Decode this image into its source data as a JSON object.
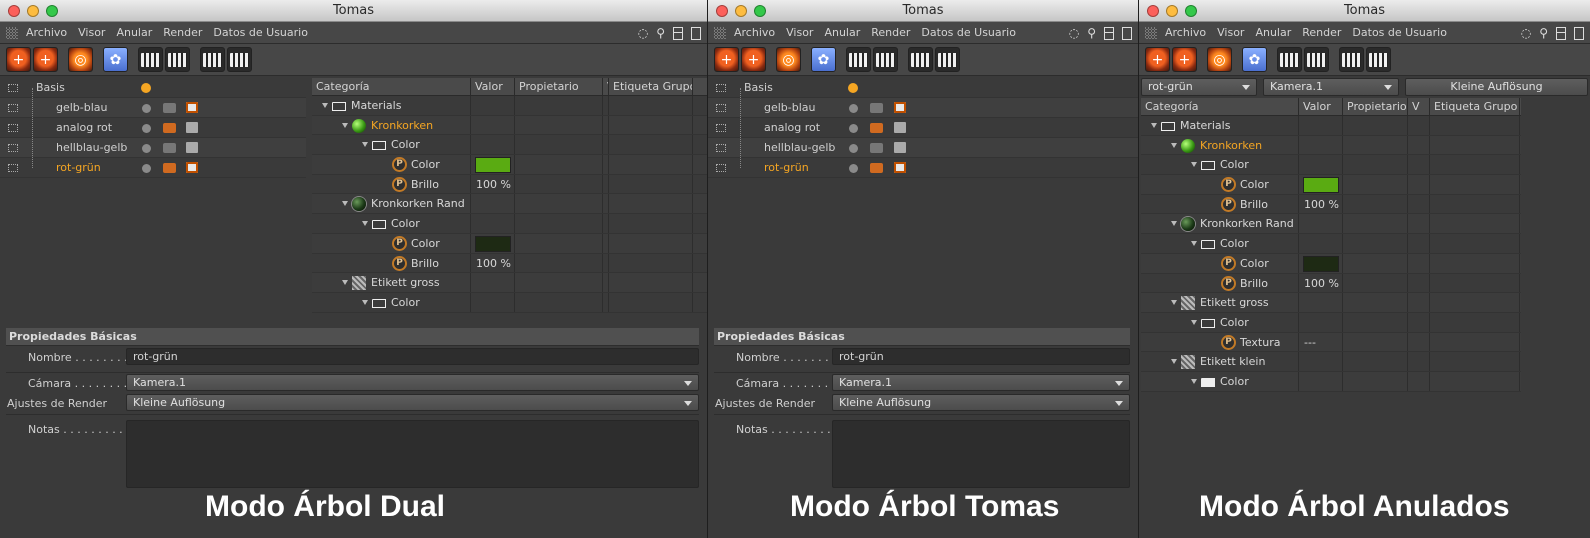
{
  "title": "Tomas",
  "menu": [
    "Archivo",
    "Visor",
    "Anular",
    "Render",
    "Datos de Usuario"
  ],
  "objects": [
    {
      "name": "Basis",
      "active": false,
      "root": true
    },
    {
      "name": "gelb-blau",
      "active": false
    },
    {
      "name": "analog rot",
      "active": false
    },
    {
      "name": "hellblau-gelb",
      "active": false
    },
    {
      "name": "rot-grün",
      "active": true
    }
  ],
  "columns": {
    "categoria": "Categoría",
    "valor": "Valor",
    "propietario": "Propietario",
    "v": "V",
    "etiqueta": "Etiqueta Grupo"
  },
  "tree": [
    {
      "label": "Materials",
      "kind": "folder",
      "indent": 0
    },
    {
      "label": "Kronkorken",
      "kind": "mat-green",
      "indent": 1,
      "highlight": true
    },
    {
      "label": "Color",
      "kind": "folder",
      "indent": 2
    },
    {
      "label": "Color",
      "kind": "param",
      "indent": 3,
      "value_swatch": "#5aab12"
    },
    {
      "label": "Brillo",
      "kind": "param",
      "indent": 3,
      "value": "100 %"
    },
    {
      "label": "Kronkorken Rand",
      "kind": "mat-dark",
      "indent": 1
    },
    {
      "label": "Color",
      "kind": "folder",
      "indent": 2
    },
    {
      "label": "Color",
      "kind": "param",
      "indent": 3,
      "value_swatch": "#1e2a14"
    },
    {
      "label": "Brillo",
      "kind": "param",
      "indent": 3,
      "value": "100 %"
    },
    {
      "label": "Etikett gross",
      "kind": "mat-stripe",
      "indent": 1
    },
    {
      "label": "Color",
      "kind": "folder",
      "indent": 2
    },
    {
      "label": "Textura",
      "kind": "param",
      "indent": 3,
      "value": "---"
    },
    {
      "label": "Etikett klein",
      "kind": "mat-stripe",
      "indent": 1
    },
    {
      "label": "Color",
      "kind": "folder-closed",
      "indent": 2
    }
  ],
  "props": {
    "section": "Propiedades Básicas",
    "nombre_label": "Nombre . . . . . . . . .",
    "nombre_value": "rot-grün",
    "camara_label": "Cámara . . . . . . . . .",
    "camara_value": "Kamera.1",
    "render_label": "Ajustes de Render",
    "render_value": "Kleine Auflösung",
    "notas_label": "Notas . . . . . . . . . . ."
  },
  "override_bar": {
    "take": "rot-grün",
    "camera": "Kamera.1",
    "render": "Kleine Auflösung"
  },
  "captions": [
    "Modo Árbol Dual",
    "Modo Árbol Tomas",
    "Modo Árbol Anulados"
  ],
  "colors": {
    "accent": "#f5a623",
    "green_swatch": "#5aab12",
    "dark_swatch": "#1e2a14"
  },
  "icons": [
    "search-icon",
    "layout-icon",
    "window-icon",
    "take-add-icon",
    "take-clone-icon",
    "override-icon",
    "auto-take-icon",
    "render-take-icon"
  ]
}
